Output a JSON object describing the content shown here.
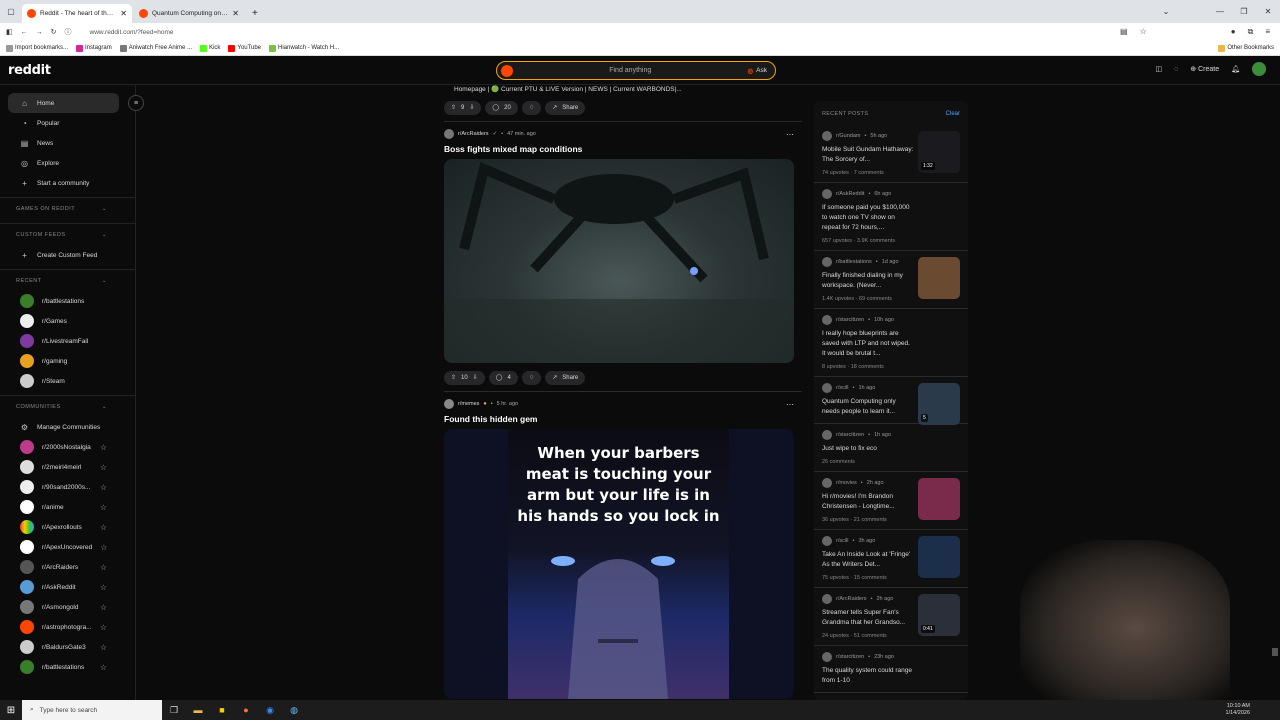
{
  "browser": {
    "tabs": [
      {
        "title": "Reddit - The heart of the intern",
        "active": true
      },
      {
        "title": "Quantum Computing only nee",
        "active": false
      }
    ],
    "url": "www.reddit.com/?feed=home",
    "bookmarks": [
      "Import bookmarks...",
      "Instagram",
      "Aniwatch Free Anime ...",
      "Kick",
      "YouTube",
      "Hianwatch - Watch H..."
    ],
    "other_bookmarks": "Other Bookmarks"
  },
  "header": {
    "logo": "reddit",
    "search_placeholder": "Find anything",
    "ask_label": "Ask",
    "create_label": "Create"
  },
  "sidebar": {
    "nav": [
      "Home",
      "Popular",
      "News",
      "Explore",
      "Start a community"
    ],
    "games_section": "GAMES ON REDDIT",
    "custom_feeds_section": "CUSTOM FEEDS",
    "create_custom_feed": "Create Custom Feed",
    "recent_section": "RECENT",
    "recent": [
      "r/battlestations",
      "r/Games",
      "r/LivestreamFail",
      "r/gaming",
      "r/Steam"
    ],
    "communities_section": "COMMUNITIES",
    "manage_communities": "Manage Communities",
    "communities": [
      "r/2000sNostalgia",
      "r/2meirl4meirl",
      "r/90sand2000s...",
      "r/anime",
      "r/Apexrollouts",
      "r/ApexUncovered",
      "r/ArcRaiders",
      "r/AskReddit",
      "r/Asmongold",
      "r/astrophotogra...",
      "r/BaldursGate3",
      "r/battlestations"
    ]
  },
  "feed": {
    "prev_crumb": "Homepage | 🟢 Current PTU & LIVE Version | NEWS | Current WARBONDS|...",
    "prev_actions": {
      "votes": "9",
      "comments": "20",
      "share": "Share"
    },
    "post1": {
      "subreddit": "r/ArcRaiders",
      "time": "47 min. ago",
      "title": "Boss fights mixed map conditions",
      "votes": "10",
      "comments": "4",
      "share": "Share"
    },
    "post2": {
      "subreddit": "r/memes",
      "time": "5 hr. ago",
      "title": "Found this hidden gem",
      "meme_text": "When your barbers meat is touching your arm but your life is in his hands so you lock in"
    }
  },
  "recent_posts": {
    "heading": "RECENT POSTS",
    "clear": "Clear",
    "items": [
      {
        "sub": "r/Gundam",
        "time": "5h ago",
        "title": "Mobile Suit Gundam Hathaway: The Sorcery of...",
        "stats": "74 upvotes · 7 comments",
        "badge": "1:32",
        "thumb": "#1a1a1f"
      },
      {
        "sub": "r/AskReddit",
        "time": "6h ago",
        "title": "If someone paid you $100,000 to watch one TV show on repeat for 72 hours,...",
        "stats": "657 upvotes · 3.9K comments",
        "badge": "",
        "thumb": ""
      },
      {
        "sub": "r/battlestations",
        "time": "1d ago",
        "title": "Finally finished dialing in my workspace. (Never...",
        "stats": "1.4K upvotes · 69 comments",
        "badge": "",
        "thumb": "#6b4a32"
      },
      {
        "sub": "r/starcitizen",
        "time": "10h ago",
        "title": "I really hope blueprints are saved with LTP and not wiped. It would be brutal t...",
        "stats": "8 upvotes · 18 comments",
        "badge": "",
        "thumb": ""
      },
      {
        "sub": "r/scill",
        "time": "1h ago",
        "title": "Quantum Computing only needs people to learn it...",
        "stats": "",
        "badge": "5",
        "thumb": "#2a3a4a"
      },
      {
        "sub": "r/starcitizen",
        "time": "1h ago",
        "title": "Just wipe to fix eco",
        "stats": "26 comments",
        "badge": "",
        "thumb": ""
      },
      {
        "sub": "r/movies",
        "time": "2h ago",
        "title": "Hi r/movies! I'm Brandon Christensen - Longtime...",
        "stats": "36 upvotes · 21 comments",
        "badge": "",
        "thumb": "#7a2a4a"
      },
      {
        "sub": "r/scill",
        "time": "3h ago",
        "title": "Take An Inside Look at 'Fringe' As the Writers Det...",
        "stats": "75 upvotes · 15 comments",
        "badge": "",
        "thumb": "#1b2e4a"
      },
      {
        "sub": "r/ArcRaiders",
        "time": "2h ago",
        "title": "Streamer tells Super Fan's Grandma that her Grandso...",
        "stats": "24 upvotes · 51 comments",
        "badge": "0:41",
        "thumb": "#2b2f3a"
      },
      {
        "sub": "r/starcitizen",
        "time": "23h ago",
        "title": "The quality system could range from 1-10",
        "stats": "",
        "badge": "",
        "thumb": ""
      }
    ]
  },
  "taskbar": {
    "search_placeholder": "Type here to search",
    "time": "10:10 AM",
    "date": "1/14/2026"
  }
}
